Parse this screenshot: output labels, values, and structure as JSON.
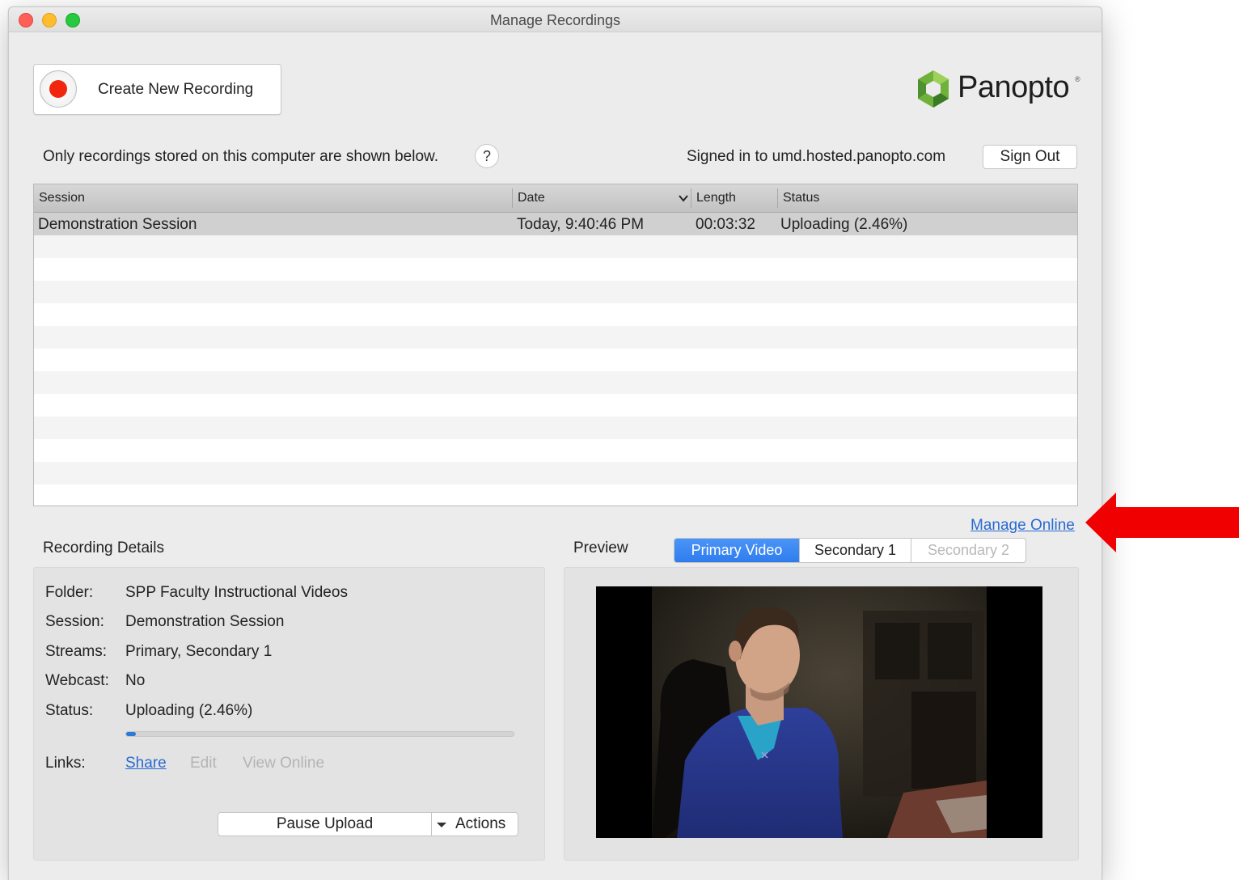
{
  "window": {
    "title": "Manage Recordings"
  },
  "toolbar": {
    "new_recording_label": "Create New Recording"
  },
  "logo": {
    "text": "Panopto",
    "tm": "®"
  },
  "info": {
    "stored_text": "Only recordings stored on this computer are shown below.",
    "help_label": "?",
    "signed_in_text": "Signed in to umd.hosted.panopto.com",
    "sign_out_label": "Sign Out"
  },
  "table": {
    "columns": [
      "Session",
      "Date",
      "Length",
      "Status"
    ],
    "rows": [
      {
        "session": "Demonstration Session",
        "date": "Today, 9:40:46 PM",
        "length": "00:03:32",
        "status": "Uploading (2.46%)"
      }
    ]
  },
  "manage_online_label": "Manage Online",
  "details": {
    "heading": "Recording Details",
    "folder_label": "Folder:",
    "folder_value": "SPP Faculty Instructional Videos",
    "session_label": "Session:",
    "session_value": "Demonstration Session",
    "streams_label": "Streams:",
    "streams_value": "Primary, Secondary 1",
    "webcast_label": "Webcast:",
    "webcast_value": "No",
    "status_label": "Status:",
    "status_value": "Uploading (2.46%)",
    "upload_progress_percent": 2.46,
    "links_label": "Links:",
    "link_share": "Share",
    "link_edit": "Edit",
    "link_view_online": "View Online",
    "pause_upload_label": "Pause Upload",
    "actions_label": "Actions"
  },
  "preview": {
    "heading": "Preview",
    "tabs": [
      "Primary Video",
      "Secondary 1",
      "Secondary 2"
    ],
    "active_tab": "Primary Video"
  },
  "colors": {
    "record_red": "#f1260f",
    "accent_blue": "#2f7cee",
    "link_blue": "#2a6ad1",
    "annotation_arrow": "#f00000"
  }
}
